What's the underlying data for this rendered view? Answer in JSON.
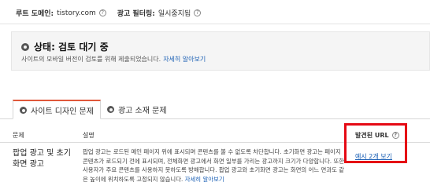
{
  "meta": {
    "root_domain_label": "루트 도메인:",
    "root_domain_value": "tistory.com",
    "ad_filter_label": "광고 필터링:",
    "ad_filter_value": "일시중지됨",
    "help_glyph": "?"
  },
  "status": {
    "title": "상태: 검토 대기 중",
    "description": "사이트의 모바일 버전이 검토를 위해 제출되었습니다.",
    "learn_more": "자세히 알아보기"
  },
  "tabs": [
    {
      "label": "사이트 디자인 문제",
      "active": true
    },
    {
      "label": "광고 소재 문제",
      "active": false
    }
  ],
  "table": {
    "headers": {
      "issue": "문제",
      "description": "설명",
      "found_urls": "발견된 URL"
    },
    "rows": [
      {
        "issue": "팝업 광고 및 초기화면 광고",
        "description": "팝업 광고는 로드된 메인 페이지 위에 표시되며 콘텐츠를 볼 수 없도록 차단합니다. 초기화면 광고는 페이지 콘텐츠가 로드되기 전에 표시되며, 전체화면 광고에서 화면 일부를 가리는 광고까지 크기가 다양합니다. 또한 사용자가 주요 콘텐츠를 사용하지 못하도록 방해합니다. 팝업 광고와 초기화면 광고는 화면의 어느 면과도 같은 높이에 위치하도록 고정되지 않습니다.",
        "learn_more": "자세히 알아보기",
        "url_link": "예시 2개 보기"
      }
    ]
  },
  "colors": {
    "link": "#1a5fb4",
    "tab_accent": "#e0583b",
    "highlight": "#e50914"
  }
}
